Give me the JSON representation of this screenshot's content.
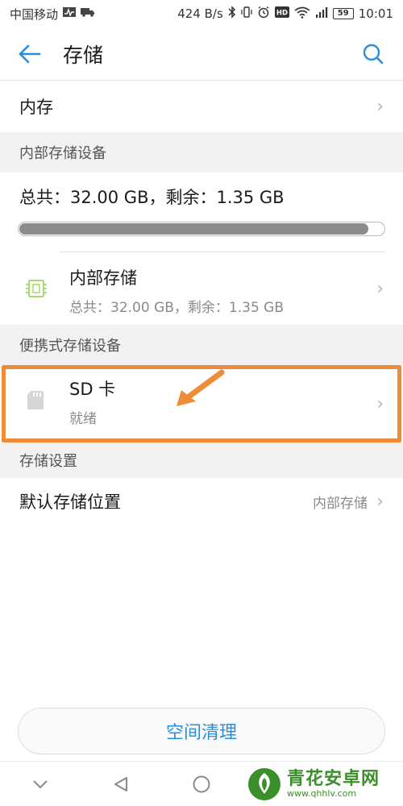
{
  "status_bar": {
    "carrier": "中国移动",
    "speed": "424 B/s",
    "battery": "59",
    "time": "10:01",
    "icons": [
      "activity-icon",
      "truck-icon",
      "bluetooth-icon",
      "vibrate-icon",
      "alarm-icon",
      "hd-icon",
      "wifi-icon",
      "signal-icon"
    ]
  },
  "header": {
    "title": "存储"
  },
  "memory_row": {
    "label": "内存"
  },
  "internal_section": {
    "header": "内部存储设备",
    "summary": "总共：32.00 GB，剩余：1.35 GB",
    "used_fraction": 0.958,
    "item": {
      "title": "内部存储",
      "subtitle": "总共：32.00 GB，剩余：1.35 GB"
    }
  },
  "portable_section": {
    "header": "便携式存储设备",
    "item": {
      "title": "SD 卡",
      "subtitle": "就绪"
    }
  },
  "settings_section": {
    "header": "存储设置",
    "default_location": {
      "label": "默认存储位置",
      "value": "内部存储"
    }
  },
  "clean_button": "空间清理",
  "nav": [
    "collapse-chevron-icon",
    "back-triangle-icon",
    "home-circle-icon"
  ],
  "watermark": {
    "title": "青花安卓网",
    "url": "www.qhhlv.com"
  },
  "colors": {
    "accent": "#2a8fd6",
    "highlight": "#ef8c3a",
    "chip_icon": "#a8d86e",
    "section_bg": "#f2f2f2",
    "watermark": "#3a8f2a"
  }
}
